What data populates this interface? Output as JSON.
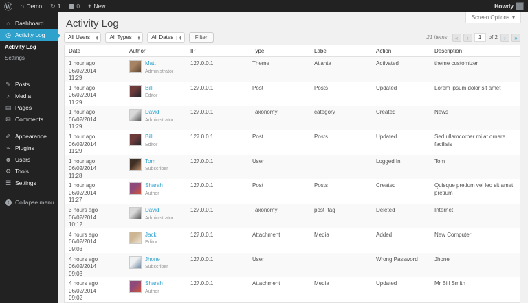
{
  "colors": {
    "accent": "#2ea2cc",
    "adminbar_bg": "#222222",
    "content_bg": "#f1f1f1",
    "row_alt": "#f9f9f9"
  },
  "admin_bar": {
    "site_name": "Demo",
    "update_count": "1",
    "comment_count": "0",
    "new_label": "New",
    "howdy": "Howdy"
  },
  "sidebar": {
    "items": [
      {
        "id": "dashboard",
        "icon": "dashboard",
        "label": "Dashboard"
      },
      {
        "id": "activity-log",
        "icon": "activity-log",
        "label": "Activity Log",
        "active": true,
        "submenu": [
          {
            "id": "activity-log",
            "label": "Activity Log",
            "current": true
          },
          {
            "id": "settings",
            "label": "Settings"
          }
        ]
      },
      {
        "id": "posts",
        "icon": "posts",
        "label": "Posts",
        "gap": 18
      },
      {
        "id": "media",
        "icon": "media",
        "label": "Media"
      },
      {
        "id": "pages",
        "icon": "pages",
        "label": "Pages"
      },
      {
        "id": "comments",
        "icon": "comments",
        "label": "Comments"
      },
      {
        "id": "appearance",
        "icon": "appearance",
        "label": "Appearance",
        "gap": 8
      },
      {
        "id": "plugins",
        "icon": "plugins",
        "label": "Plugins"
      },
      {
        "id": "users",
        "icon": "users",
        "label": "Users"
      },
      {
        "id": "tools",
        "icon": "tools",
        "label": "Tools"
      },
      {
        "id": "settings",
        "icon": "settings",
        "label": "Settings"
      },
      {
        "id": "collapse",
        "icon": "collapse",
        "label": "Collapse menu",
        "gap": 10,
        "collapse": true
      }
    ]
  },
  "page": {
    "title": "Activity Log",
    "screen_options": "Screen Options",
    "screen_options_caret": "▾"
  },
  "filters": {
    "users": "All Users",
    "types": "All Types",
    "dates": "All Dates",
    "button": "Filter"
  },
  "pagination": {
    "items_text": "21 items",
    "first": "«",
    "prev": "‹",
    "current": "1",
    "of": "of 2",
    "next": "›",
    "last": "»"
  },
  "table": {
    "columns": [
      "Date",
      "Author",
      "IP",
      "Type",
      "Label",
      "Action",
      "Description"
    ],
    "rows": [
      {
        "ago": "1 hour ago",
        "date": "06/02/2014",
        "time": "11:29",
        "author": "Matt",
        "role": "Administrator",
        "ip": "127.0.0.1",
        "type": "Theme",
        "label": "Atlanta",
        "action": "Activated",
        "description": "theme customizer",
        "avatar_colors": [
          "#a68363",
          "#5f4633"
        ]
      },
      {
        "ago": "1 hour ago",
        "date": "06/02/2014",
        "time": "11:29",
        "author": "Bill",
        "role": "Editor",
        "ip": "127.0.0.1",
        "type": "Post",
        "label": "Posts",
        "action": "Updated",
        "description": "Lorem ipsum dolor sit amet",
        "avatar_colors": [
          "#6e3b3b",
          "#22262e"
        ]
      },
      {
        "ago": "1 hour ago",
        "date": "06/02/2014",
        "time": "11:29",
        "author": "David",
        "role": "Administrator",
        "ip": "127.0.0.1",
        "type": "Taxonomy",
        "label": "category",
        "action": "Created",
        "description": "News",
        "avatar_colors": [
          "#d9d9d9",
          "#5a5a5a"
        ]
      },
      {
        "ago": "1 hour ago",
        "date": "06/02/2014",
        "time": "11:29",
        "author": "Bill",
        "role": "Editor",
        "ip": "127.0.0.1",
        "type": "Post",
        "label": "Posts",
        "action": "Updated",
        "description": "Sed ullamcorper mi at ornare facilisis",
        "avatar_colors": [
          "#6e3b3b",
          "#22262e"
        ]
      },
      {
        "ago": "1 hour ago",
        "date": "06/02/2014",
        "time": "11:28",
        "author": "Tom",
        "role": "Subscriber",
        "ip": "127.0.0.1",
        "type": "User",
        "label": "",
        "action": "Logged In",
        "description": "Tom",
        "avatar_colors": [
          "#3f2f24",
          "#b98a68"
        ]
      },
      {
        "ago": "1 hour ago",
        "date": "06/02/2014",
        "time": "11:27",
        "author": "Sharah",
        "role": "Author",
        "ip": "127.0.0.1",
        "type": "Post",
        "label": "Posts",
        "action": "Created",
        "description": "Quisque pretium vel leo sit amet pretium",
        "avatar_colors": [
          "#8e4a7a",
          "#d2543a"
        ]
      },
      {
        "ago": "3 hours ago",
        "date": "06/02/2014",
        "time": "10:12",
        "author": "David",
        "role": "Administrator",
        "ip": "127.0.0.1",
        "type": "Taxonomy",
        "label": "post_tag",
        "action": "Deleted",
        "description": "Internet",
        "avatar_colors": [
          "#d9d9d9",
          "#5a5a5a"
        ]
      },
      {
        "ago": "4 hours ago",
        "date": "06/02/2014",
        "time": "09:03",
        "author": "Jack",
        "role": "Editor",
        "ip": "127.0.0.1",
        "type": "Attachment",
        "label": "Media",
        "action": "Added",
        "description": "New Computer",
        "avatar_colors": [
          "#cdb693",
          "#efe6d6"
        ]
      },
      {
        "ago": "4 hours ago",
        "date": "06/02/2014",
        "time": "09:03",
        "author": "Jhone",
        "role": "Subscriber",
        "ip": "127.0.0.1",
        "type": "User",
        "label": "",
        "action": "Wrong Password",
        "description": "Jhone",
        "avatar_colors": [
          "#eef1f2",
          "#6d86a0"
        ]
      },
      {
        "ago": "4 hours ago",
        "date": "06/02/2014",
        "time": "09:02",
        "author": "Sharah",
        "role": "Author",
        "ip": "127.0.0.1",
        "type": "Attachment",
        "label": "Media",
        "action": "Updated",
        "description": "Mr Bill Smith",
        "avatar_colors": [
          "#8e4a7a",
          "#d2543a"
        ]
      }
    ]
  }
}
